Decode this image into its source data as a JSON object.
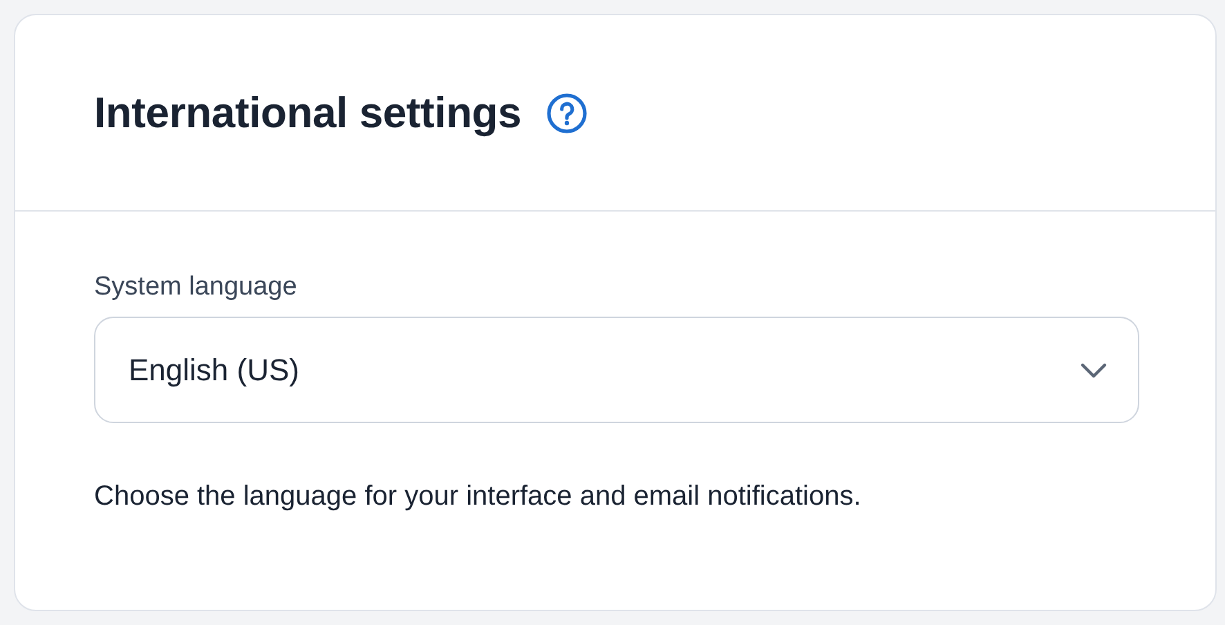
{
  "card": {
    "title": "International settings"
  },
  "field": {
    "label": "System language",
    "value": "English (US)",
    "help": "Choose the language for your interface and email notifications."
  }
}
